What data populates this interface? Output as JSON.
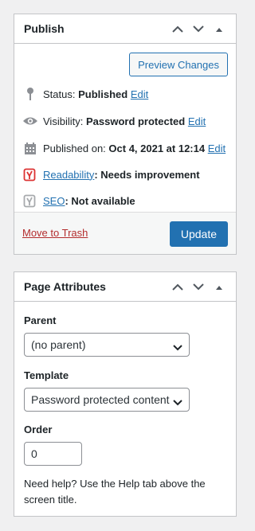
{
  "publish": {
    "title": "Publish",
    "preview_label": "Preview Changes",
    "status_label": "Status:",
    "status_value": "Published",
    "visibility_label": "Visibility:",
    "visibility_value": "Password protected",
    "published_label": "Published on:",
    "published_value": "Oct 4, 2021 at 12:14",
    "edit_label": "Edit",
    "readability_link": "Readability",
    "readability_value": ": Needs improvement",
    "seo_link": "SEO",
    "seo_value": ": Not available",
    "trash_label": "Move to Trash",
    "update_label": "Update"
  },
  "attributes": {
    "title": "Page Attributes",
    "parent_label": "Parent",
    "parent_value": "(no parent)",
    "template_label": "Template",
    "template_value": "Password protected content",
    "order_label": "Order",
    "order_value": "0",
    "help_text": "Need help? Use the Help tab above the screen title."
  },
  "colors": {
    "link": "#2271b1",
    "trash": "#b32d2e",
    "primary": "#2271b1",
    "yoast_red": "#dc3232"
  },
  "icons": [
    "chevron-up-icon",
    "chevron-down-icon",
    "triangle-up-icon",
    "pin-icon",
    "eye-icon",
    "calendar-icon",
    "yoast-icon"
  ]
}
